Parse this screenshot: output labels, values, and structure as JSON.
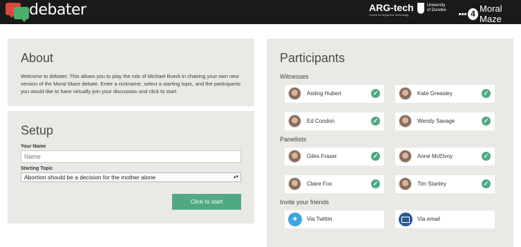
{
  "header": {
    "brand": "debater",
    "arg_tech": "ARG-tech",
    "arg_tech_sub": "Centre for Argument Technology",
    "dundee": [
      "University",
      "of Dundee"
    ],
    "bbc_number": "4",
    "bbc_show": "Moral Maze"
  },
  "about": {
    "title": "About",
    "text": "Welcome to debater. This allows you to play the role of Michael Buerk in chairing your own new version of the Moral Maze debate. Enter a nickname, select a starting topic, and the participants you would like to have virtually join your discussion and click to start."
  },
  "setup": {
    "title": "Setup",
    "name_label": "Your Name",
    "name_placeholder": "Name",
    "topic_label": "Starting Topic",
    "topic_value": "Abortion should be a decision for the mother alone",
    "start_button": "Click to start"
  },
  "participants": {
    "title": "Participants",
    "witnesses_label": "Witnesses",
    "witnesses": [
      "Aisling Hubert",
      "Kate Greasley",
      "Ed Condon",
      "Wendy Savage"
    ],
    "panellists_label": "Panellists",
    "panellists": [
      "Giles Fraser",
      "Anne McElvoy",
      "Claire Fox",
      "Tim Stanley"
    ],
    "invite_label": "Invite your friends",
    "invite": [
      "Via Twitter",
      "Via email"
    ]
  },
  "colors": {
    "accent": "#4faa83",
    "panel": "#ebe9e6",
    "topbar": "#1a1a1a",
    "twitter": "#3ea5e0",
    "email": "#2a5a94"
  }
}
